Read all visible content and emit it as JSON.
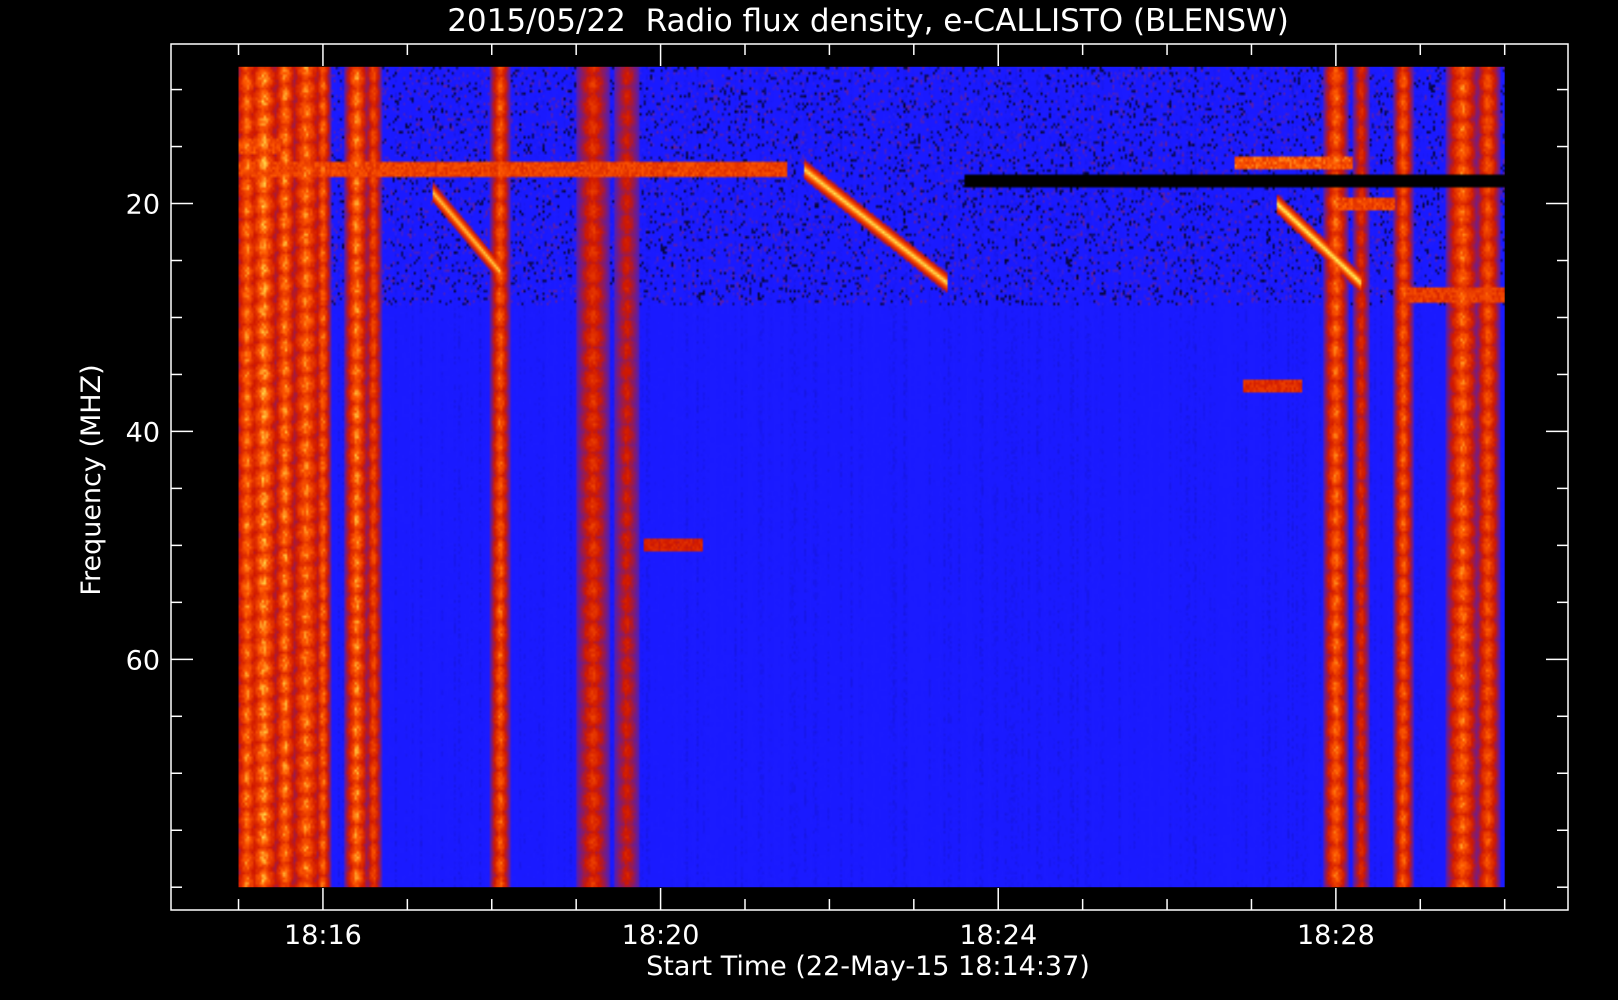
{
  "chart_data": {
    "type": "heatmap",
    "title": "2015/05/22  Radio flux density, e-CALLISTO (BLENSW)",
    "xlabel": "Start Time (22-May-15 18:14:37)",
    "ylabel": "Frequency (MHZ)",
    "x_ticks": [
      {
        "minute": 16,
        "label": "18:16"
      },
      {
        "minute": 20,
        "label": "18:20"
      },
      {
        "minute": 24,
        "label": "18:24"
      },
      {
        "minute": 28,
        "label": "18:28"
      }
    ],
    "y_ticks": [
      {
        "mhz": 20,
        "label": "20"
      },
      {
        "mhz": 40,
        "label": "40"
      },
      {
        "mhz": 60,
        "label": "60"
      }
    ],
    "xlim_minutes": [
      14.2,
      30.75
    ],
    "data_time_range_minutes": [
      15.0,
      30.0
    ],
    "ylim_mhz": [
      6,
      82
    ],
    "data_freq_range_mhz": [
      8,
      80
    ],
    "colormap": [
      "#000000",
      "#1a1aff",
      "#2020ff",
      "#d01800",
      "#ff5a00",
      "#ffff60"
    ],
    "background_level": "blue",
    "bright_columns": [
      {
        "t": 15.1,
        "level": 0.9,
        "width": 0.15
      },
      {
        "t": 15.3,
        "level": 1.0,
        "width": 0.2
      },
      {
        "t": 15.55,
        "level": 0.95,
        "width": 0.15
      },
      {
        "t": 15.8,
        "level": 0.9,
        "width": 0.2
      },
      {
        "t": 16.0,
        "level": 0.85,
        "width": 0.1
      },
      {
        "t": 16.4,
        "level": 0.95,
        "width": 0.15
      },
      {
        "t": 16.6,
        "level": 0.7,
        "width": 0.1
      },
      {
        "t": 18.1,
        "level": 0.8,
        "width": 0.12
      },
      {
        "t": 19.2,
        "level": 0.55,
        "width": 0.2
      },
      {
        "t": 19.6,
        "level": 0.4,
        "width": 0.15
      },
      {
        "t": 28.0,
        "level": 0.85,
        "width": 0.15
      },
      {
        "t": 28.3,
        "level": 0.5,
        "width": 0.1
      },
      {
        "t": 28.8,
        "level": 0.8,
        "width": 0.12
      },
      {
        "t": 29.5,
        "level": 0.85,
        "width": 0.2
      },
      {
        "t": 29.8,
        "level": 0.75,
        "width": 0.15
      }
    ],
    "drift_bursts": [
      {
        "t_start": 17.3,
        "f_start": 19,
        "t_end": 18.1,
        "f_end": 26,
        "level": 0.9
      },
      {
        "t_start": 21.7,
        "f_start": 17,
        "t_end": 23.4,
        "f_end": 27,
        "level": 0.95
      },
      {
        "t_start": 27.3,
        "f_start": 20,
        "t_end": 28.3,
        "f_end": 27,
        "level": 1.0
      }
    ],
    "horizontal_bands": [
      {
        "f": 15,
        "t_start": 15.0,
        "t_end": 15.5,
        "level": 0.8
      },
      {
        "f": 17,
        "t_start": 15.0,
        "t_end": 21.5,
        "level": 0.75
      },
      {
        "f": 18,
        "t_start": 23.6,
        "t_end": 30.0,
        "level": 0.0
      },
      {
        "f": 16.5,
        "t_start": 26.8,
        "t_end": 28.2,
        "level": 0.9
      },
      {
        "f": 20,
        "t_start": 28.0,
        "t_end": 28.7,
        "level": 0.8
      },
      {
        "f": 28,
        "t_start": 28.8,
        "t_end": 30.0,
        "level": 0.7
      },
      {
        "f": 36,
        "t_start": 26.9,
        "t_end": 27.6,
        "level": 0.6
      },
      {
        "f": 50,
        "t_start": 19.8,
        "t_end": 20.5,
        "level": 0.5
      }
    ]
  }
}
